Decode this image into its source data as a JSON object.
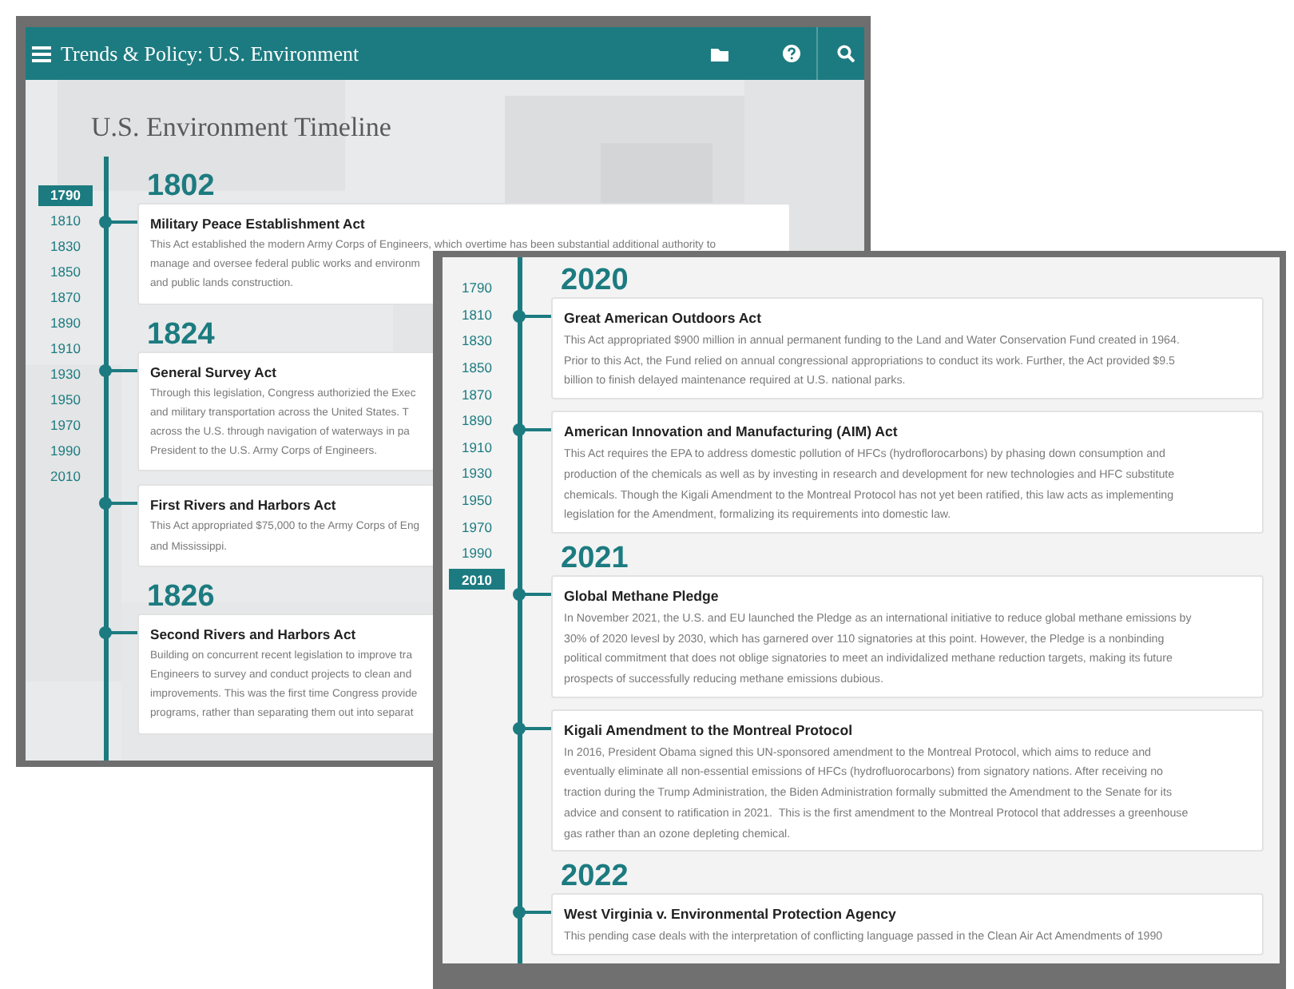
{
  "back_window": {
    "app_bar": {
      "title": "Trends & Policy: U.S. Environment"
    },
    "page_title": "U.S. Environment Timeline",
    "decades": [
      {
        "label": "1790",
        "selected": true
      },
      {
        "label": "1810",
        "selected": false
      },
      {
        "label": "1830",
        "selected": false
      },
      {
        "label": "1850",
        "selected": false
      },
      {
        "label": "1870",
        "selected": false
      },
      {
        "label": "1890",
        "selected": false
      },
      {
        "label": "1910",
        "selected": false
      },
      {
        "label": "1930",
        "selected": false
      },
      {
        "label": "1950",
        "selected": false
      },
      {
        "label": "1970",
        "selected": false
      },
      {
        "label": "1990",
        "selected": false
      },
      {
        "label": "2010",
        "selected": false
      }
    ],
    "years": [
      {
        "year": "1802",
        "entries": [
          {
            "title": "Military Peace Establishment Act",
            "lines": [
              "This Act established the modern Army Corps of Engineers, which overtime has been substantial additional authority to",
              "manage and oversee federal public works and environm",
              "and public lands construction."
            ]
          }
        ]
      },
      {
        "year": "1824",
        "entries": [
          {
            "title": "General Survey Act",
            "lines": [
              "Through this legislation, Congress authorizied the Exec",
              "and military transportation across the United States. T",
              "across the U.S. through navigation of waterways in pa",
              "President to the U.S. Army Corps of Engineers."
            ]
          },
          {
            "title": "First Rivers and Harbors Act",
            "lines": [
              "This Act appropriated $75,000 to the Army Corps of Eng",
              "and Mississippi."
            ]
          }
        ]
      },
      {
        "year": "1826",
        "entries": [
          {
            "title": "Second Rivers and Harbors Act",
            "lines": [
              "Building on concurrent recent legislation to improve tra",
              "Engineers to survey and conduct projects to clean and",
              "improvements. This was the first time Congress provide",
              "programs, rather than separating them out into separat"
            ]
          }
        ]
      }
    ]
  },
  "front_window": {
    "decades": [
      {
        "label": "1790",
        "selected": false
      },
      {
        "label": "1810",
        "selected": false
      },
      {
        "label": "1830",
        "selected": false
      },
      {
        "label": "1850",
        "selected": false
      },
      {
        "label": "1870",
        "selected": false
      },
      {
        "label": "1890",
        "selected": false
      },
      {
        "label": "1910",
        "selected": false
      },
      {
        "label": "1930",
        "selected": false
      },
      {
        "label": "1950",
        "selected": false
      },
      {
        "label": "1970",
        "selected": false
      },
      {
        "label": "1990",
        "selected": false
      },
      {
        "label": "2010",
        "selected": true
      }
    ],
    "years": [
      {
        "year": "2020",
        "entries": [
          {
            "title": "Great American Outdoors Act",
            "lines": [
              "This Act appropriated $900 million in annual permanent funding to the Land and Water Conservation Fund created in 1964.",
              "Prior to this Act, the Fund relied on annual congressional appropriations to conduct its work. Further, the Act provided $9.5",
              "billion to finish delayed maintenance required at U.S. national parks."
            ]
          },
          {
            "title": "American Innovation and Manufacturing (AIM) Act",
            "lines": [
              "This Act requires the EPA to address domestic pollution of HFCs (hydroflorocarbons) by phasing down consumption and",
              "production of the chemicals as well as by investing in research and development for new technologies and HFC substitute",
              "chemicals. Though the Kigali Amendment to the Montreal Protocol has not yet been ratified, this law acts as implementing",
              "legislation for the Amendment, formalizing its requirements into domestic law."
            ]
          }
        ]
      },
      {
        "year": "2021",
        "entries": [
          {
            "title": "Global Methane Pledge",
            "lines": [
              "In November 2021, the U.S. and EU launched the Pledge as an international initiative to reduce global methane emissions by",
              "30% of 2020 levesl by 2030, which has garnered over 110 signatories at this point. However, the Pledge is a nonbinding",
              "political commitment that does not oblige signatories to meet an individalized methane reduction targets, making its future",
              "prospects of successfully reducing methane emissions dubious."
            ]
          },
          {
            "title": "Kigali Amendment to the Montreal Protocol",
            "lines": [
              "In 2016, President Obama signed this UN-sponsored amendment to the Montreal Protocol, which aims to reduce and",
              "eventually eliminate all non-essential emissions of HFCs (hydrofluorocarbons) from signatory nations. After receiving no",
              "traction during the Trump Administration, the Biden Administration formally submitted the Amendment to the Senate for its",
              "advice and consent to ratification in 2021.  This is the first amendment to the Montreal Protocol that addresses a greenhouse",
              "gas rather than an ozone depleting chemical."
            ]
          }
        ]
      },
      {
        "year": "2022",
        "entries": [
          {
            "title": "West Virginia v. Environmental Protection Agency",
            "lines": [
              "This pending case deals with the interpretation of conflicting language passed in the Clean Air Act Amendments of 1990"
            ]
          }
        ]
      }
    ]
  }
}
